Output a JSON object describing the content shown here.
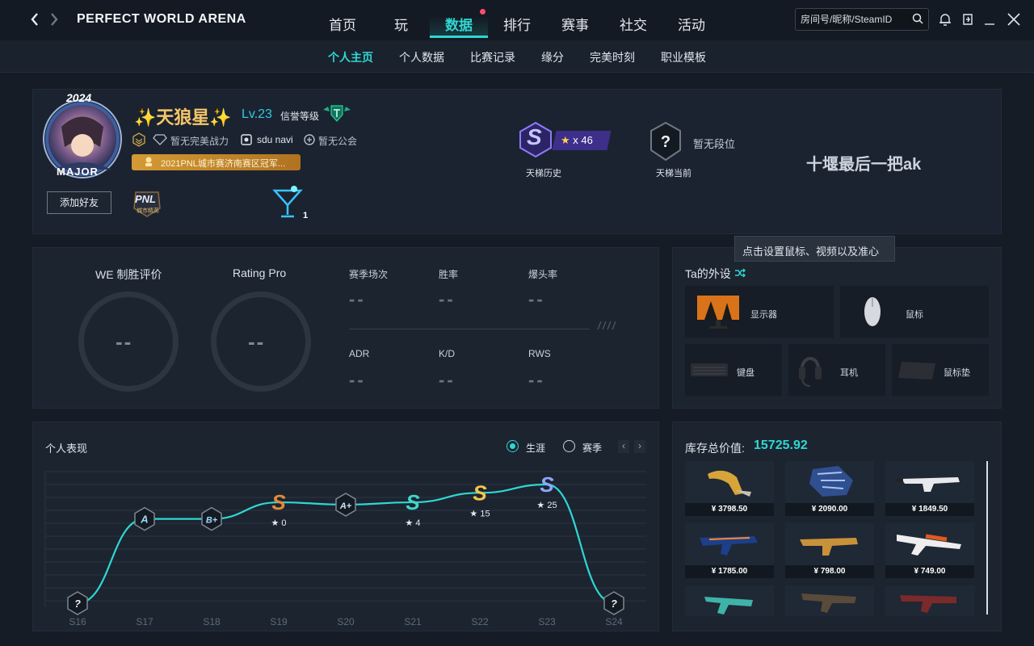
{
  "header": {
    "brand": "PERFECT WORLD ARENA",
    "tabs": [
      "首页",
      "玩",
      "数据",
      "排行",
      "赛事",
      "社交",
      "活动"
    ],
    "search_placeholder": "房间号/昵称/SteamID"
  },
  "subnav": [
    "个人主页",
    "个人数据",
    "比赛记录",
    "缘分",
    "完美时刻",
    "职业模板"
  ],
  "profile": {
    "name": "✨天狼星✨",
    "level": "Lv.23",
    "credit_label": "信誉等级",
    "no_power": "暂无完美战力",
    "team": "sdu navi",
    "guild": "暂无公会",
    "honor": "2021PNL城市赛济南赛区冠军...",
    "add_friend": "添加好友",
    "avatar_badge_year": "2024",
    "avatar_badge_text": "MAJOR",
    "pnl_badge": "PNL",
    "pnl_sub": "城市精英",
    "cocktail_count": "1",
    "ladder_history_label": "天梯历史",
    "ladder_stars": "x 46",
    "ladder_current_label": "天梯当前",
    "no_rank": "暂无段位",
    "motto": "十堰最后一把ak"
  },
  "stats": {
    "we_label": "WE 制胜评价",
    "we_value": "--",
    "rating_label": "Rating Pro",
    "rating_value": "--",
    "items": [
      {
        "label": "赛季场次",
        "value": "--"
      },
      {
        "label": "胜率",
        "value": "--"
      },
      {
        "label": "爆头率",
        "value": "--"
      },
      {
        "label": "ADR",
        "value": "--"
      },
      {
        "label": "K/D",
        "value": "--"
      },
      {
        "label": "RWS",
        "value": "--"
      }
    ]
  },
  "gear": {
    "title": "Ta的外设",
    "tooltip": "点击设置鼠标、视频以及准心",
    "items": [
      "显示器",
      "鼠标",
      "键盘",
      "耳机",
      "鼠标垫"
    ]
  },
  "performance": {
    "title": "个人表现",
    "radio_career": "生涯",
    "radio_season": "赛季",
    "seasons": [
      "S16",
      "S17",
      "S18",
      "S19",
      "S20",
      "S21",
      "S22",
      "S23",
      "S24"
    ],
    "grades": [
      "?",
      "A",
      "B+",
      "S",
      "A+",
      "S",
      "S",
      "S",
      "?"
    ],
    "stars": [
      "",
      "",
      "",
      "★ 0",
      "",
      "★ 4",
      "★ 15",
      "★ 25",
      ""
    ],
    "curve_levels": [
      0.0,
      0.71,
      0.71,
      0.85,
      0.83,
      0.85,
      0.93,
      1.0,
      0.0
    ],
    "accent": "#2fd7d2"
  },
  "inventory": {
    "title": "库存总价值:",
    "total": "15725.92",
    "prices": [
      "¥ 3798.50",
      "¥ 2090.00",
      "¥ 1849.50",
      "¥ 1785.00",
      "¥ 798.00",
      "¥ 749.00",
      "",
      "",
      ""
    ]
  }
}
